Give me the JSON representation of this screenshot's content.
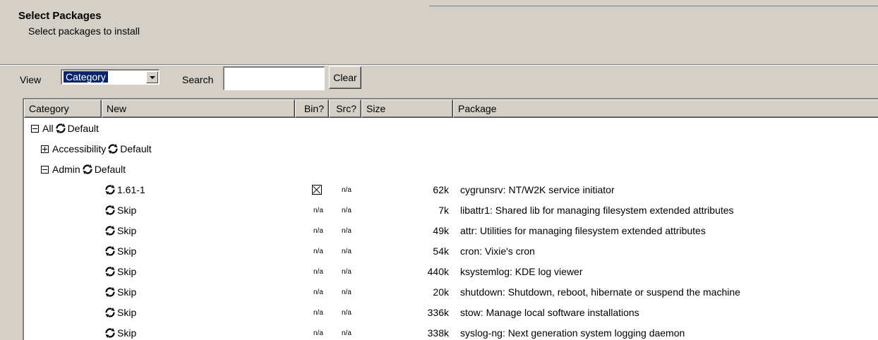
{
  "header": {
    "title": "Select Packages",
    "subtitle": "Select packages to install"
  },
  "toolbar": {
    "view_label": "View",
    "view_selected": "Category",
    "search_label": "Search",
    "search_value": "",
    "clear_label": "Clear"
  },
  "columns": {
    "category": "Category",
    "new": "New",
    "bin": "Bin?",
    "src": "Src?",
    "size": "Size",
    "package": "Package"
  },
  "tree": [
    {
      "expander": "minus",
      "name": "All",
      "action": "Default"
    },
    {
      "expander": "plus",
      "name": "Accessibility",
      "action": "Default"
    },
    {
      "expander": "minus",
      "name": "Admin",
      "action": "Default"
    }
  ],
  "packages": [
    {
      "new": "1.61-1",
      "bin": "checked",
      "src": "n/a",
      "size": "62k",
      "package": "cygrunsrv: NT/W2K service initiator"
    },
    {
      "new": "Skip",
      "bin": "n/a",
      "src": "n/a",
      "size": "7k",
      "package": "libattr1: Shared lib for managing filesystem extended attributes"
    },
    {
      "new": "Skip",
      "bin": "n/a",
      "src": "n/a",
      "size": "49k",
      "package": "attr: Utilities for managing filesystem extended attributes"
    },
    {
      "new": "Skip",
      "bin": "n/a",
      "src": "n/a",
      "size": "54k",
      "package": "cron: Vixie's cron"
    },
    {
      "new": "Skip",
      "bin": "n/a",
      "src": "n/a",
      "size": "440k",
      "package": "ksystemlog: KDE log viewer"
    },
    {
      "new": "Skip",
      "bin": "n/a",
      "src": "n/a",
      "size": "20k",
      "package": "shutdown: Shutdown, reboot, hibernate or suspend the machine"
    },
    {
      "new": "Skip",
      "bin": "n/a",
      "src": "n/a",
      "size": "336k",
      "package": "stow: Manage local software installations"
    },
    {
      "new": "Skip",
      "bin": "n/a",
      "src": "n/a",
      "size": "338k",
      "package": "syslog-ng: Next generation system logging daemon"
    }
  ],
  "colors": {
    "face": "#d4d0c8",
    "selection": "#0a246a"
  }
}
